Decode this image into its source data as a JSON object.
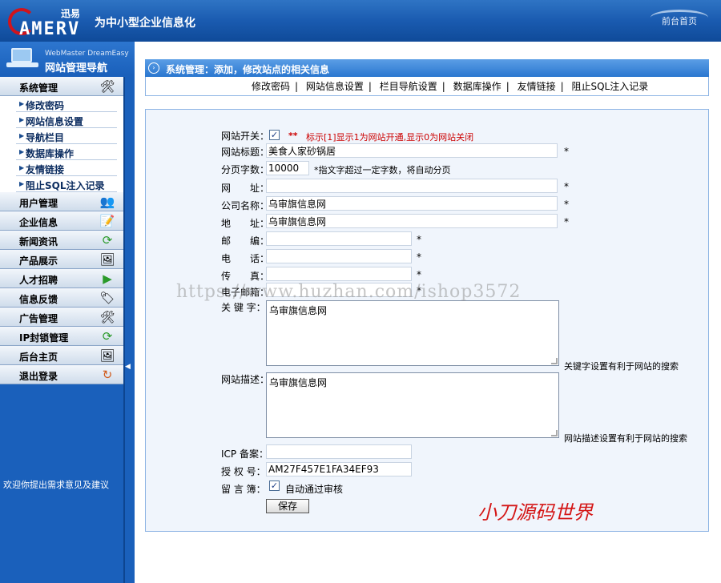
{
  "header": {
    "logo_cn": "迅易",
    "logo_en": "AMERV",
    "slogan": "为中小型企业信息化",
    "home_link": "前台首页"
  },
  "sidebar": {
    "sub_title": "WebMaster DreamEasy",
    "main_title": "网站管理导航",
    "menus": [
      {
        "label": "系统管理",
        "icon": "tools-icon",
        "items": [
          "修改密码",
          "网站信息设置",
          "导航栏目",
          "数据库操作",
          "友情链接",
          "阻止SQL注入记录"
        ]
      },
      {
        "label": "用户管理",
        "icon": "users-icon"
      },
      {
        "label": "企业信息",
        "icon": "edit-icon"
      },
      {
        "label": "新闻资讯",
        "icon": "refresh-icon"
      },
      {
        "label": "产品展示",
        "icon": "picture-icon"
      },
      {
        "label": "人才招聘",
        "icon": "play-icon"
      },
      {
        "label": "信息反馈",
        "icon": "tag-icon"
      },
      {
        "label": "广告管理",
        "icon": "tools-icon"
      },
      {
        "label": "IP封锁管理",
        "icon": "refresh-icon"
      },
      {
        "label": "后台主页",
        "icon": "picture-icon"
      },
      {
        "label": "退出登录",
        "icon": "logout-icon"
      }
    ],
    "footer": "欢迎你提出需求意见及建议"
  },
  "main": {
    "title": "系统管理：添加，修改站点的相关信息",
    "subnav": [
      "修改密码",
      "网站信息设置",
      "栏目导航设置",
      "数据库操作",
      "友情链接",
      "阻止SQL注入记录"
    ]
  },
  "form": {
    "site_switch_label": "网站开关：",
    "site_switch_note_stars": "**",
    "site_switch_note": "标示[1]显示1为网站开通,显示0为网站关闭",
    "site_title_label": "网站标题：",
    "site_title_value": "美食人家砂锅居",
    "page_words_label": "分页字数：",
    "page_words_value": "10000",
    "page_words_hint": "*指文字超过一定字数，将自动分页",
    "url_label": "网　　址：",
    "url_value": "",
    "company_label": "公司名称：",
    "company_value": "乌审旗信息网",
    "address_label": "地　　址：",
    "address_value": "乌审旗信息网",
    "postcode_label": "邮　　编：",
    "phone_label": "电　　话：",
    "fax_label": "传　　真：",
    "email_label": "电子邮箱：",
    "keywords_label": "关 键 字：",
    "keywords_value": "乌审旗信息网",
    "keywords_hint": "关键字设置有利于网站的搜索",
    "desc_label": "网站描述：",
    "desc_value": "乌审旗信息网",
    "desc_hint": "网站描述设置有利于网站的搜索",
    "icp_label": "ICP 备案：",
    "icp_value": "",
    "license_label": "授 权 号：",
    "license_value": "AM27F457E1FA34EF93",
    "guestbook_label": "留 言 簿：",
    "guestbook_check_label": "自动通过审核",
    "save_label": "保存",
    "required_star": "*"
  },
  "overlay": {
    "watermark": "https://www.huzhan.com/ishop3572",
    "brand": "小刀源码世界"
  }
}
